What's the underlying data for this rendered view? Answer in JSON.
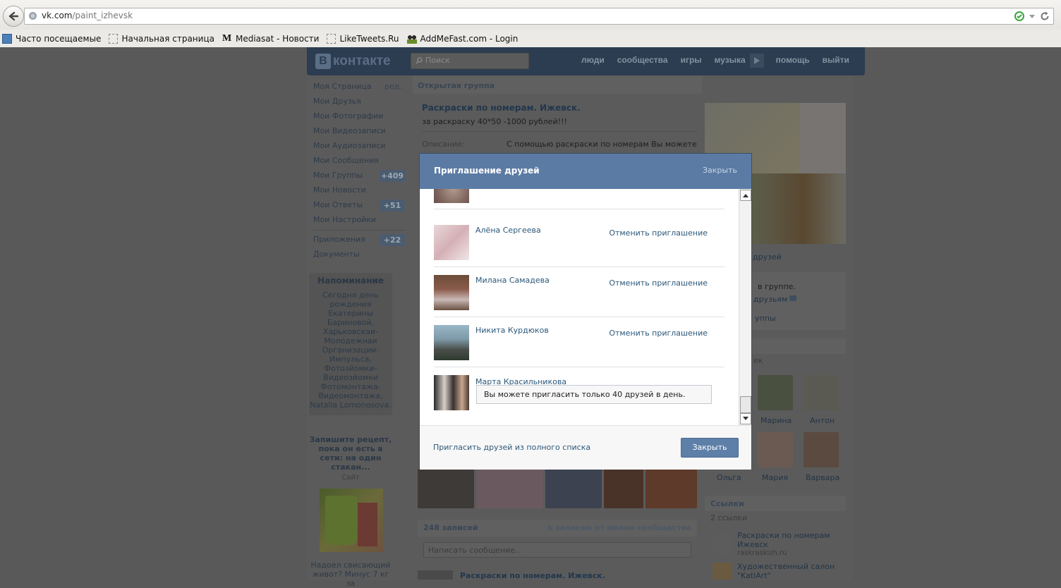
{
  "browser": {
    "url_host": "vk.com",
    "url_path": "/paint_izhevsk",
    "bookmarks": [
      {
        "label": "Часто посещаемые",
        "icon": "frequent-icon"
      },
      {
        "label": "Начальная страница",
        "icon": "page-icon"
      },
      {
        "label": "Mediasat - Новости",
        "icon": "mediasat-icon"
      },
      {
        "label": "LikeTweets.Ru",
        "icon": "page-icon"
      },
      {
        "label": "AddMeFast.com - Login",
        "icon": "addmefast-icon"
      }
    ]
  },
  "vk": {
    "logo_text": "контакте",
    "logo_letter": "В",
    "search_placeholder": "Поиск",
    "top_nav": [
      "люди",
      "сообщества",
      "игры",
      "музыка",
      "помощь",
      "выйти"
    ],
    "sidebar": {
      "edit": "ред.",
      "items": [
        {
          "label": "Моя Страница"
        },
        {
          "label": "Мои Друзья"
        },
        {
          "label": "Мои Фотографии"
        },
        {
          "label": "Мои Видеозаписи"
        },
        {
          "label": "Мои Аудиозаписи"
        },
        {
          "label": "Мои Сообщения"
        },
        {
          "label": "Мои Группы",
          "badge": "+409"
        },
        {
          "label": "Мои Новости"
        },
        {
          "label": "Мои Ответы",
          "badge": "+51"
        },
        {
          "label": "Мои Настройки"
        },
        {
          "label": "Приложения",
          "badge": "+22"
        },
        {
          "label": "Документы"
        }
      ],
      "reminder_title": "Напоминание",
      "reminder_text": [
        "Сегодня день",
        "рождения",
        "Екатерины",
        "Бариновой,",
        "Харьковскаи-",
        "Молодежнаи",
        "Организации-",
        "Импульса,",
        "Фотозйомки-",
        "Видеозйомки",
        "Фотомонтажа-",
        "Видеомонтажа,",
        "Natalia Lomonosova."
      ],
      "ad_title": [
        "Запишите рецепт,",
        "пока он есть в",
        "сети: на один",
        "стакан..."
      ],
      "ad_site": "Сайт",
      "ad2": [
        "Надоел свисающий",
        "живот? Минус 7 кг за"
      ]
    },
    "group": {
      "type": "Открытая группа",
      "name": "Раскраски по номерам. Ижевск.",
      "status": "за раскраску 40*50 -1000 рублей!!!",
      "desc_label": "Описание:",
      "desc_value": "С помощью раскраски по номерам Вы можете",
      "posts_count": "248 записей",
      "posts_link": "к записям от имени сообщества",
      "write_placeholder": "Написать сообщение..",
      "post_author": "Раскраски по номерам. Ижевск."
    },
    "right": {
      "invite_friends": "друзей",
      "in_group": "в группе.",
      "friends": "друзьям",
      "groups": "уппы",
      "members_tail": "ек",
      "member_names": [
        "Марина",
        "Антон",
        "Ольга",
        "Мария",
        "Варвара"
      ],
      "links_title": "Ссылки",
      "links_count": "2 ссылки",
      "links": [
        {
          "title": "Раскраски по номерам",
          "title2": "Ижевск",
          "url": "raskraskizh.ru"
        },
        {
          "title": "Художественный салон",
          "title2": "\"KatiArt\""
        }
      ]
    }
  },
  "modal": {
    "title": "Приглашение друзей",
    "close_link": "Закрыть",
    "friends": [
      {
        "name": "",
        "action": ""
      },
      {
        "name": "Алёна Сергеева",
        "action": "Отменить приглашение"
      },
      {
        "name": "Милана Самадева",
        "action": "Отменить приглашение"
      },
      {
        "name": "Никита Курдюков",
        "action": "Отменить приглашение"
      },
      {
        "name": "Марта Красильникова",
        "action": ""
      }
    ],
    "limit_message": "Вы можете пригласить только 40 друзей в день.",
    "invite_full_list": "Пригласить друзей из полного списка",
    "close_button": "Закрыть"
  }
}
